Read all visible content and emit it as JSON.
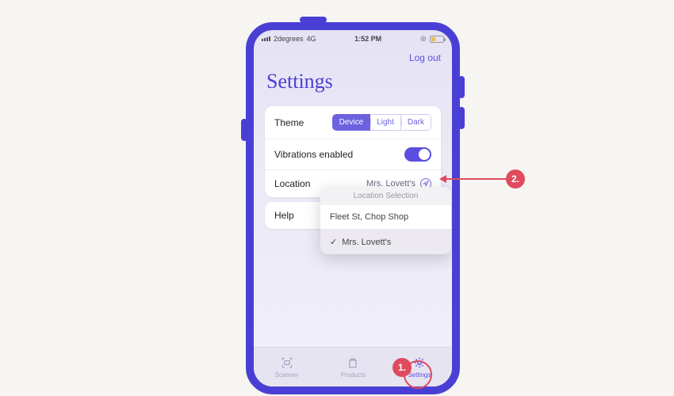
{
  "statusbar": {
    "carrier": "2degrees",
    "network": "4G",
    "time": "1:52 PM"
  },
  "header": {
    "logout": "Log out",
    "title": "Settings"
  },
  "theme": {
    "label": "Theme",
    "options": {
      "device": "Device",
      "light": "Light",
      "dark": "Dark"
    },
    "selected": "device"
  },
  "vibrations": {
    "label": "Vibrations enabled",
    "enabled": true
  },
  "location": {
    "label": "Location",
    "current": "Mrs. Lovett's",
    "popover_title": "Location Selection",
    "options": [
      "Fleet St, Chop Shop",
      "Mrs. Lovett's"
    ]
  },
  "help": {
    "label": "Help"
  },
  "tabs": {
    "scanner": "Scanner",
    "products": "Products",
    "settings": "Settings"
  },
  "annotations": {
    "one": "1.",
    "two": "2."
  }
}
